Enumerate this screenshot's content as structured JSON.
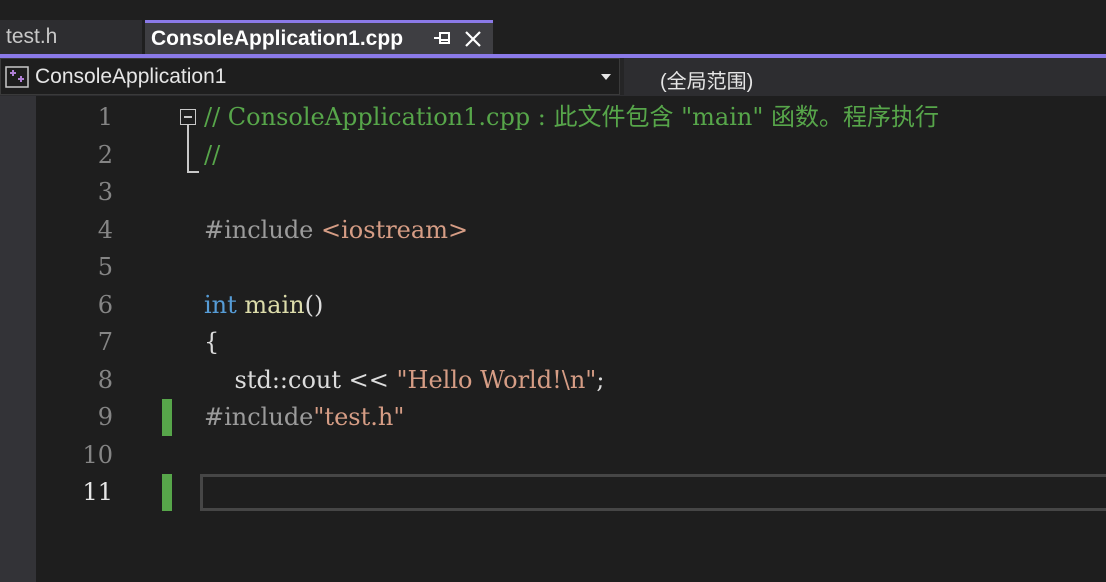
{
  "tabs": [
    {
      "label": "test.h",
      "active": false
    },
    {
      "label": "ConsoleApplication1.cpp",
      "active": true
    }
  ],
  "navbar": {
    "project": "ConsoleApplication1",
    "scope": "(全局范围)"
  },
  "editor": {
    "current_line": 11,
    "lines": [
      {
        "number": "1",
        "tokens": [
          {
            "text": "// ConsoleApplication1.cpp : 此文件包含 \"main\" 函数。程序执行",
            "kind": "comment"
          }
        ]
      },
      {
        "number": "2",
        "tokens": [
          {
            "text": "//",
            "kind": "comment"
          }
        ]
      },
      {
        "number": "3",
        "tokens": []
      },
      {
        "number": "4",
        "tokens": [
          {
            "text": "#include ",
            "kind": "pre"
          },
          {
            "text": "<iostream>",
            "kind": "string"
          }
        ]
      },
      {
        "number": "5",
        "tokens": []
      },
      {
        "number": "6",
        "tokens": [
          {
            "text": "int",
            "kind": "keyword"
          },
          {
            "text": " ",
            "kind": "plain"
          },
          {
            "text": "main",
            "kind": "func"
          },
          {
            "text": "()",
            "kind": "plain"
          }
        ]
      },
      {
        "number": "7",
        "tokens": [
          {
            "text": "{",
            "kind": "plain"
          }
        ]
      },
      {
        "number": "8",
        "tokens": [
          {
            "text": "    std::cout << ",
            "kind": "plain"
          },
          {
            "text": "\"Hello World!\\n\"",
            "kind": "string"
          },
          {
            "text": ";",
            "kind": "plain"
          }
        ]
      },
      {
        "number": "9",
        "tokens": [
          {
            "text": "#include",
            "kind": "pre"
          },
          {
            "text": "\"test.h\"",
            "kind": "string"
          }
        ]
      },
      {
        "number": "10",
        "tokens": []
      },
      {
        "number": "11",
        "tokens": []
      }
    ],
    "changed_lines": [
      9,
      11
    ]
  },
  "colors": {
    "accent": "#8b7ae8",
    "comment": "#57a64a",
    "keyword": "#569cd6",
    "string": "#d69d85",
    "function": "#dcdcaa",
    "preprocessor": "#9b9b9b",
    "change_indicator": "#57a64a"
  },
  "icons": {
    "pin": "pin-icon",
    "close": "close-icon",
    "project": "cpp-project-icon",
    "dropdown": "chevron-down-icon",
    "collapse": "collapse-icon"
  }
}
